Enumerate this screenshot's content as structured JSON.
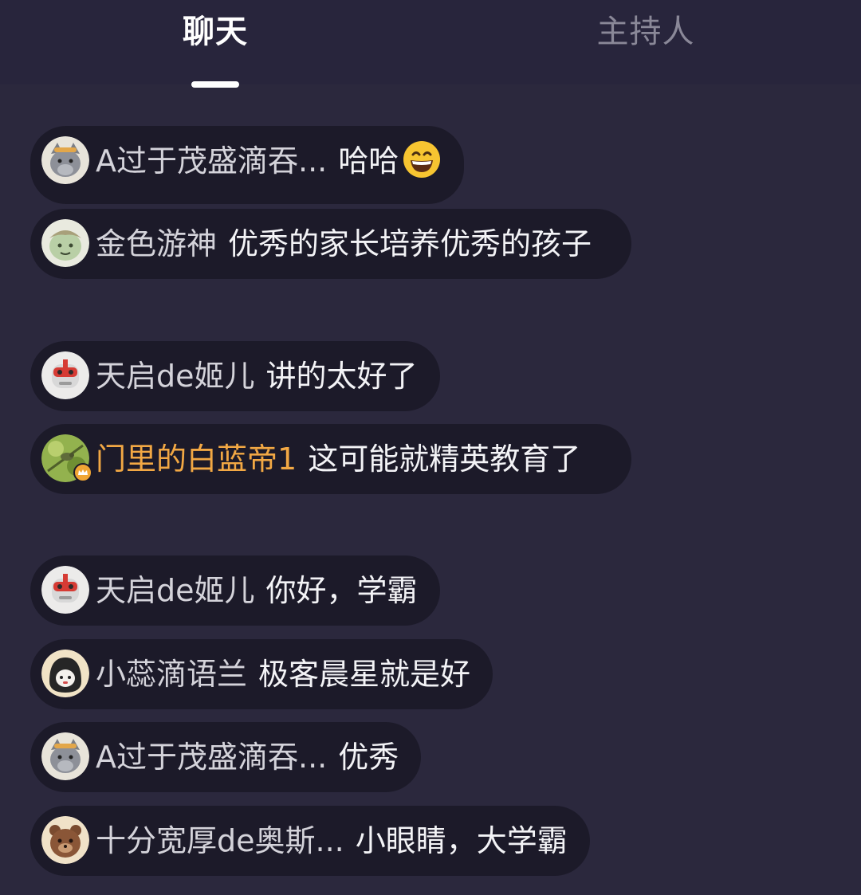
{
  "tabs": {
    "chat_label": "聊天",
    "host_label": "主持人"
  },
  "messages": [
    {
      "user": "A过于茂盛滴吞...",
      "text": "哈哈",
      "avatar": "gray-wolf-avatar",
      "emoji": "grinning-face-icon"
    },
    {
      "user": "金色游神",
      "text": "优秀的家长培养优秀的孩子",
      "avatar": "green-creature-avatar"
    },
    {
      "user": "天启de姬儿",
      "text": "讲的太好了",
      "avatar": "red-robot-avatar"
    },
    {
      "user": "门里的白蓝帝1",
      "text": "这可能就精英教育了",
      "avatar": "bird-photo-avatar",
      "user_color": "#f2a844",
      "badge": "vip-crown-badge"
    },
    {
      "user": "天启de姬儿",
      "text": "你好，学霸",
      "avatar": "red-robot-avatar"
    },
    {
      "user": "小蕊滴语兰",
      "text": "极客晨星就是好",
      "avatar": "black-hood-avatar"
    },
    {
      "user": "A过于茂盛滴吞...",
      "text": "优秀",
      "avatar": "gray-wolf-avatar"
    },
    {
      "user": "十分宽厚de奥斯...",
      "text": "小眼睛，大学霸",
      "avatar": "brown-bear-avatar"
    }
  ],
  "colors": {
    "background": "#2b283d",
    "bubble": "#1c1a29",
    "accent_username": "#f2a844",
    "active_tab": "#ffffff",
    "inactive_tab": "#8a8898"
  }
}
